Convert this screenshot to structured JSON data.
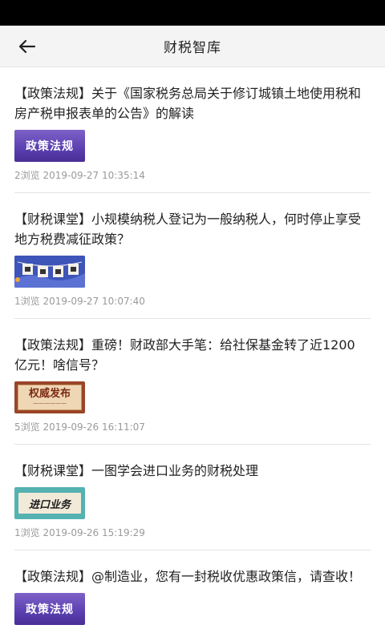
{
  "header": {
    "title": "财税智库"
  },
  "articles": [
    {
      "title": "【政策法规】关于《国家税务总局关于修订城镇土地使用税和房产税申报表单的公告》的解读",
      "thumb_text": "政策法规",
      "meta": "2浏览 2019-09-27 10:35:14"
    },
    {
      "title": "【财税课堂】小规模纳税人登记为一般纳税人，何时停止享受地方税费减征政策？",
      "thumb_text": "",
      "meta": "1浏览 2019-09-27 10:07:40"
    },
    {
      "title": "【政策法规】重磅！财政部大手笔：给社保基金转了近1200亿元！啥信号？",
      "thumb_text": "权威发布",
      "meta": "5浏览 2019-09-26 16:11:07"
    },
    {
      "title": "【财税课堂】一图学会进口业务的财税处理",
      "thumb_text": "进口业务",
      "meta": "1浏览 2019-09-26 15:19:29"
    },
    {
      "title": "【政策法规】@制造业，您有一封税收优惠政策信，请查收！",
      "thumb_text": "政策法规",
      "meta": ""
    }
  ],
  "colors": {
    "status_bar": "#000000",
    "header_bg": "#f4f4f4",
    "meta_text": "#9a9a9a"
  },
  "icons": {
    "back": "arrow-left-icon"
  }
}
